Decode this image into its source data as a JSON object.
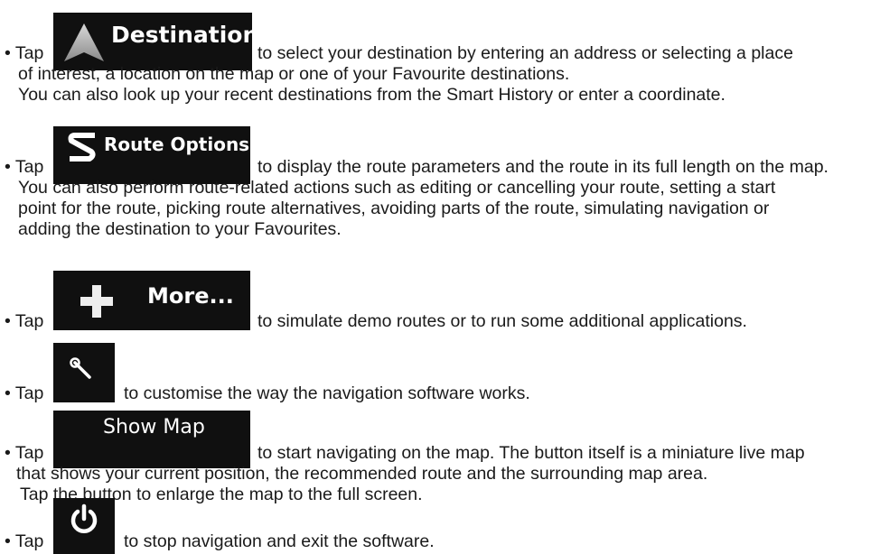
{
  "bullet_prefix": "• Tap",
  "items": [
    {
      "button_label": "Destination",
      "button_icon": "navigation-arrow-icon",
      "lines": [
        "to select your destination by entering an address or selecting a place",
        "of interest, a location on the map or one of your Favourite destinations.",
        "You can also look up your recent destinations from the Smart History or enter a coordinate."
      ]
    },
    {
      "button_label": "Route Options",
      "button_icon": "route-s-icon",
      "lines": [
        "to display the route parameters and the route in its full length on the map.",
        "You can also perform route-related actions such as editing or cancelling your route, setting a start",
        "point for the route, picking route alternatives, avoiding parts of the route, simulating navigation or",
        "adding the destination to your Favourites."
      ]
    },
    {
      "button_label": "More...",
      "button_icon": "plus-icon",
      "lines": [
        "to simulate demo routes or to run some additional applications."
      ]
    },
    {
      "button_label": "",
      "button_icon": "wrench-icon",
      "lines": [
        "to customise the way the navigation software works."
      ]
    },
    {
      "button_label": "Show Map",
      "button_icon": "",
      "lines": [
        "to start navigating on the map. The button itself is a miniature live map",
        "that shows your current position, the recommended route and the surrounding map area.",
        "Tap the button to enlarge the map to the full screen."
      ]
    },
    {
      "button_label": "",
      "button_icon": "power-icon",
      "lines": [
        "to stop navigation and exit the software."
      ]
    }
  ]
}
